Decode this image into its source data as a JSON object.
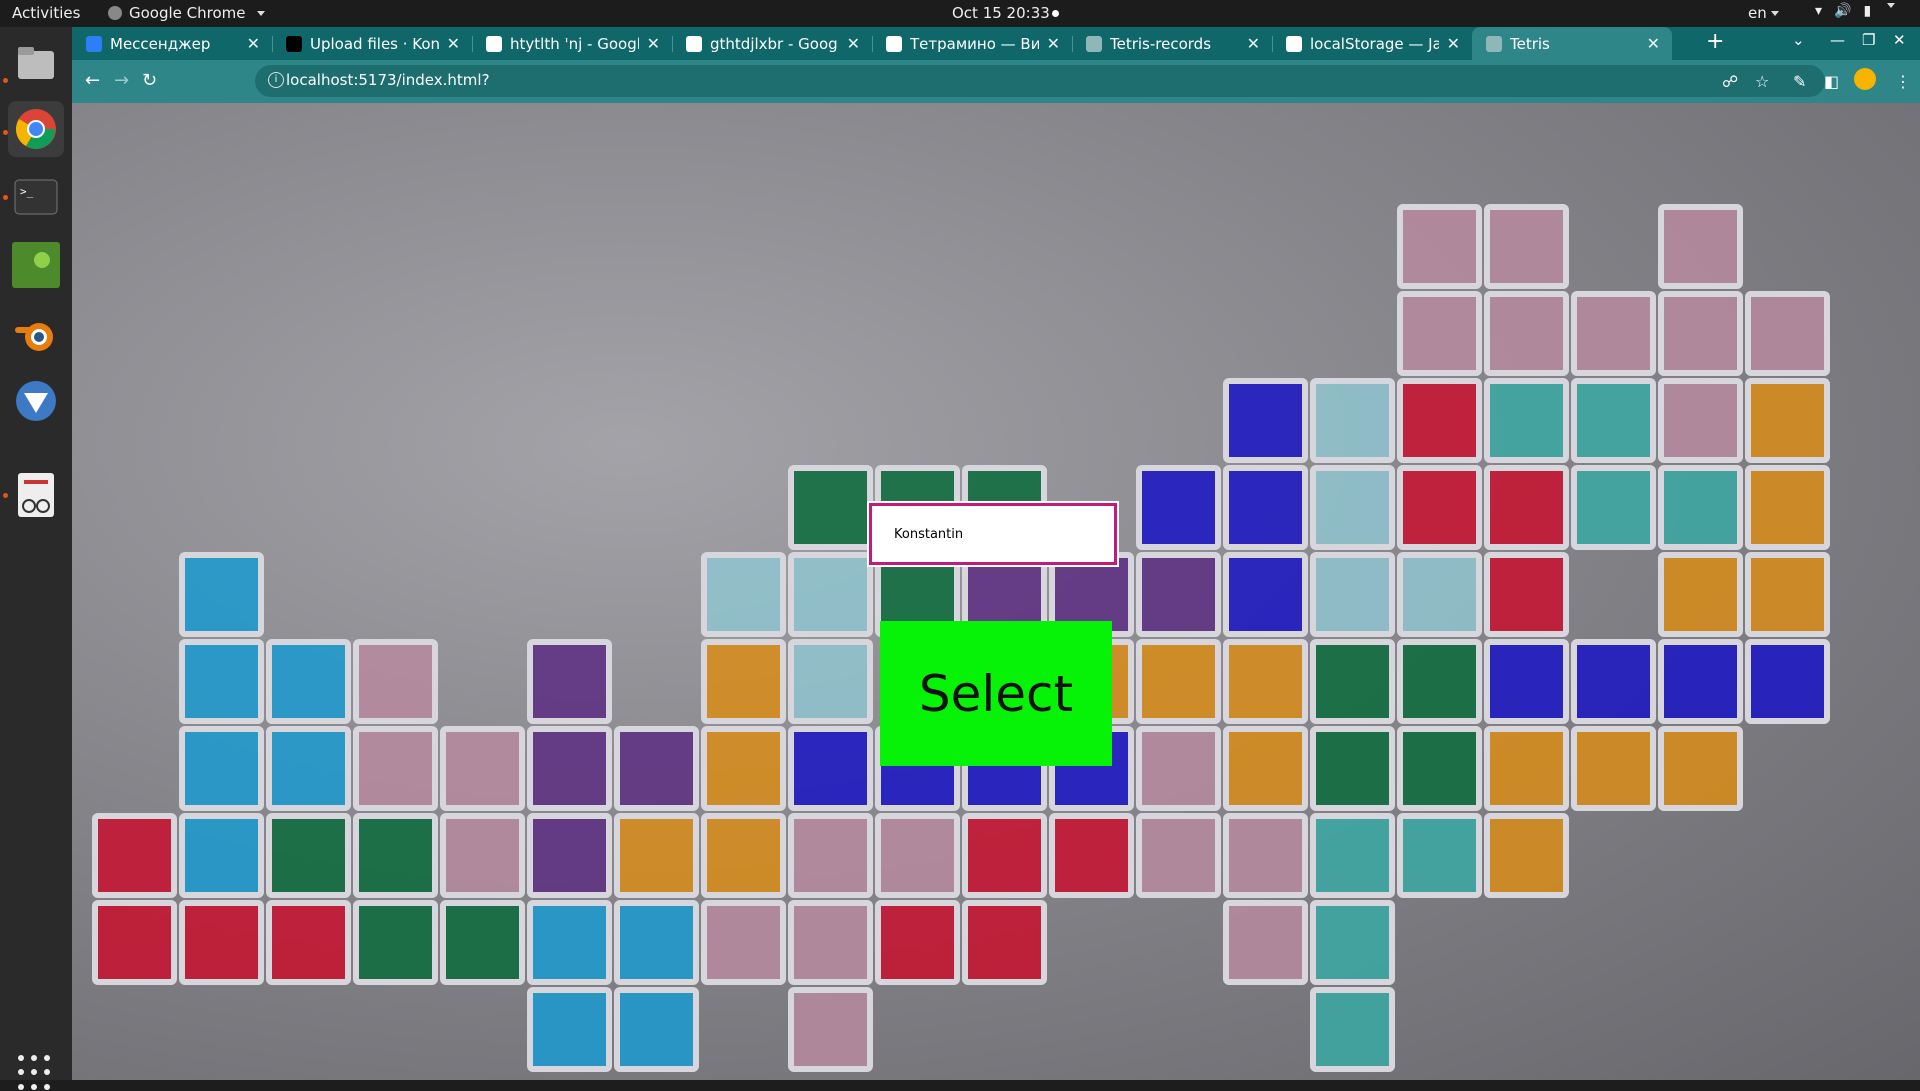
{
  "topbar": {
    "activities": "Activities",
    "app_name": "Google Chrome",
    "clock": "Oct 15  20:33",
    "language": "en"
  },
  "dock": {
    "items": [
      "files-icon",
      "chrome-icon",
      "terminal-icon",
      "image-viewer-icon",
      "blender-icon",
      "inkscape-icon",
      "document-viewer-icon"
    ],
    "apps_grid": "show-applications-icon"
  },
  "browser": {
    "tabs": [
      {
        "title": "Мессенджер",
        "favicon": "messenger-icon",
        "color": "#2d7ff9"
      },
      {
        "title": "Upload files · Konst",
        "favicon": "github-icon",
        "color": "#000000"
      },
      {
        "title": "htytlth 'nj - Google S",
        "favicon": "google-icon",
        "color": "#ffffff"
      },
      {
        "title": "gthtdjlxbr - Google",
        "favicon": "google-icon",
        "color": "#ffffff"
      },
      {
        "title": "Тетрамино — Вики",
        "favicon": "wikipedia-icon",
        "color": "#ffffff"
      },
      {
        "title": "Tetris-records",
        "favicon": "globe-icon",
        "color": "#8fb7b8"
      },
      {
        "title": "localStorage — Jav",
        "favicon": "mdn-icon",
        "color": "#ffffff"
      },
      {
        "title": "Tetris",
        "favicon": "globe-icon",
        "color": "#8fb7b8",
        "active": true
      }
    ],
    "url": "localhost:5173/index.html?",
    "accent": "#2e8688",
    "tabstrip_color": "#0f676a"
  },
  "game": {
    "name_input_value": "Konstantin",
    "select_label": "Select",
    "select_color": "#06f206",
    "input_border_color": "#c21b7a"
  }
}
